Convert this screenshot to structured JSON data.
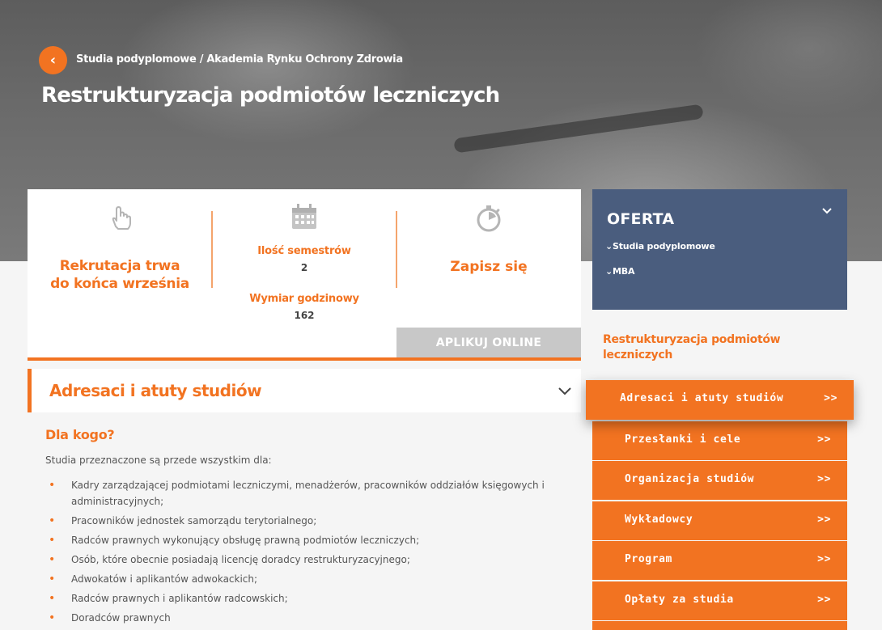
{
  "hero": {
    "back_icon": "chevron-left-icon",
    "breadcrumb": "Studia podyplomowe / Akademia Rynku Ochrony Zdrowia",
    "title": "Restrukturyzacja podmiotów leczniczych"
  },
  "info": {
    "recruitment_line1": "Rekrutacja trwa",
    "recruitment_line2": "do końca września",
    "semesters_label": "Ilość semestrów",
    "semesters_value": "2",
    "hours_label": "Wymiar godzinowy",
    "hours_value": "162",
    "signup_label": "Zapisz się",
    "apply_button": "APLIKUJ ONLINE",
    "icons": [
      "hand-pointer-icon",
      "calendar-icon",
      "stopwatch-icon"
    ]
  },
  "section": {
    "title": "Adresaci i atuty studiów",
    "heading": "Dla kogo?",
    "intro": "Studia przeznaczone są przede wszystkim dla:",
    "items": [
      "Kadry zarządzającej podmiotami leczniczymi, menadżerów, pracowników oddziałów księgowych i administracyjnych;",
      "Pracowników jednostek samorządu terytorialnego;",
      "Radców prawnych wykonujący obsługę prawną podmiotów leczniczych;",
      "Osób, które obecnie posiadają licencję doradcy restrukturyzacyjnego;",
      "Adwokatów i aplikantów adwokackich;",
      "Radców prawnych i aplikantów radcowskich;",
      "Doradców prawnych"
    ]
  },
  "sidebar": {
    "oferta_title": "OFERTA",
    "oferta_items": [
      "Studia podyplomowe",
      "MBA"
    ],
    "current": "Restrukturyzacja podmiotów leczniczych",
    "menu": [
      {
        "label": "Adresaci i atuty studiów",
        "arrow": ">>"
      },
      {
        "label": "Przesłanki i cele",
        "arrow": ">>"
      },
      {
        "label": "Organizacja studiów",
        "arrow": ">>"
      },
      {
        "label": "Wykładowcy",
        "arrow": ">>"
      },
      {
        "label": "Program",
        "arrow": ">>"
      },
      {
        "label": "Opłaty za studia",
        "arrow": ">>"
      }
    ]
  },
  "colors": {
    "accent": "#f27321",
    "oferta_bg": "#4a5d7e",
    "apply_bg": "#c8c8c8"
  }
}
